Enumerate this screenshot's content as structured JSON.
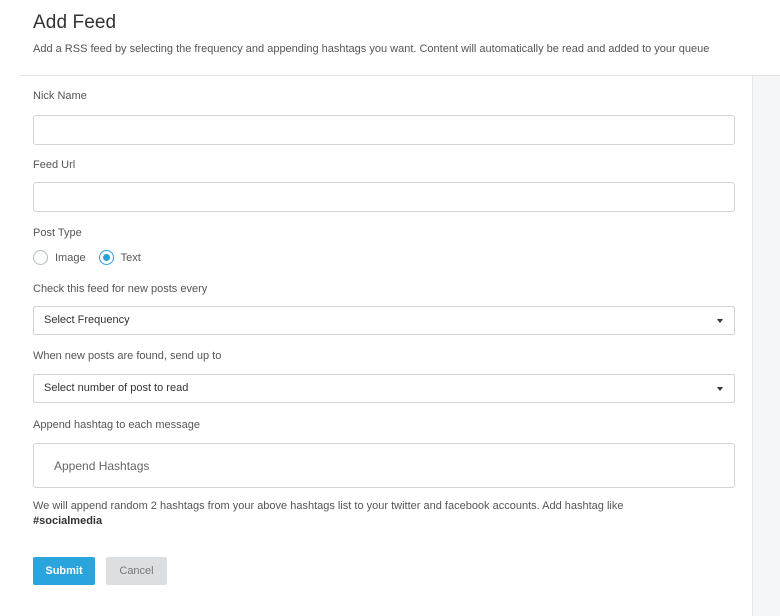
{
  "header": {
    "title": "Add Feed",
    "subtitle": "Add a RSS feed by selecting the frequency and appending hashtags you want. Content will automatically be read and added to your queue"
  },
  "form": {
    "nick_name": {
      "label": "Nick Name",
      "value": ""
    },
    "feed_url": {
      "label": "Feed Url",
      "value": ""
    },
    "post_type": {
      "label": "Post Type",
      "options": [
        {
          "label": "Image",
          "checked": false
        },
        {
          "label": "Text",
          "checked": true
        }
      ]
    },
    "frequency": {
      "label": "Check this feed for new posts every",
      "selected": "Select Frequency"
    },
    "post_count": {
      "label": "When new posts are found, send up to",
      "selected": "Select number of post to read"
    },
    "hashtags": {
      "label": "Append hashtag to each message",
      "placeholder": "Append Hashtags",
      "hint": "We will append random 2 hashtags from your above hashtags list to your twitter and facebook accounts. Add hashtag like",
      "hint_example": "#socialmedia"
    }
  },
  "actions": {
    "submit_label": "Submit",
    "cancel_label": "Cancel"
  },
  "colors": {
    "accent": "#2aa4dd",
    "cancel_bg": "#dcdfe2"
  }
}
